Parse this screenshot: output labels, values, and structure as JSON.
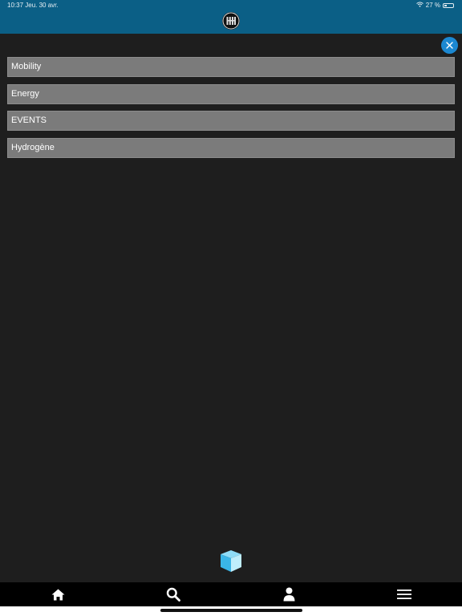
{
  "status_bar": {
    "time_date": "10:37  Jeu. 30 avr.",
    "battery": "27 %"
  },
  "menu": {
    "items": [
      {
        "label": "Mobility"
      },
      {
        "label": "Energy"
      },
      {
        "label": "EVENTS"
      },
      {
        "label": "Hydrogène"
      }
    ]
  },
  "icons": {
    "logo": "brand-logo-icon",
    "close": "close-icon",
    "cube": "cube-icon",
    "home": "home-icon",
    "search": "search-icon",
    "profile": "user-icon",
    "menu": "hamburger-menu-icon"
  },
  "colors": {
    "header": "#0b5f86",
    "background": "#1e1e1e",
    "item": "#7b7b7b",
    "close_button": "#1c88d1",
    "nav": "#000000",
    "cube": "#3ab6e8"
  }
}
